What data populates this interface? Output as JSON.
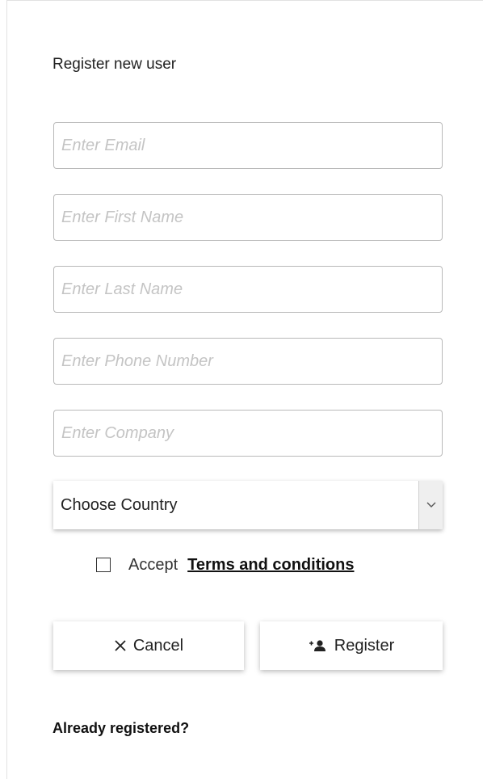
{
  "form": {
    "title": "Register new user",
    "fields": [
      {
        "name": "email",
        "placeholder": "Enter Email",
        "value": ""
      },
      {
        "name": "first_name",
        "placeholder": "Enter First Name",
        "value": ""
      },
      {
        "name": "last_name",
        "placeholder": "Enter Last Name",
        "value": ""
      },
      {
        "name": "phone",
        "placeholder": "Enter Phone Number",
        "value": ""
      },
      {
        "name": "company",
        "placeholder": "Enter Company",
        "value": ""
      }
    ],
    "country_select": {
      "selected": "Choose Country",
      "icon": "chevron-down-icon"
    },
    "terms": {
      "checked": false,
      "accept_label": "Accept",
      "link_label": "Terms and conditions"
    },
    "buttons": {
      "cancel": {
        "label": "Cancel",
        "icon": "close-icon"
      },
      "register": {
        "label": "Register",
        "icon": "add-user-icon"
      }
    },
    "already_registered": "Already registered?"
  }
}
